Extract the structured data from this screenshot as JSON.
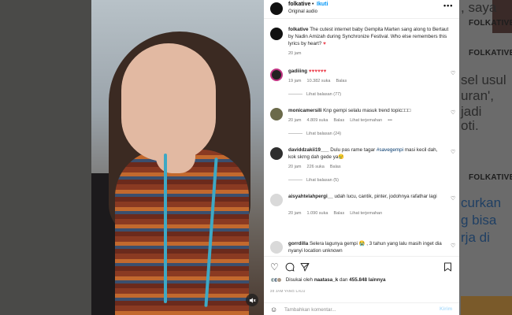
{
  "background": {
    "brand_top": "FOLKATIVE",
    "brand_mid": "FOLKATIVE",
    "brand_low": "FOLKATIVE",
    "snippet_top": ", saya",
    "snippet_lines_1": [
      "sel usul",
      "uran',",
      "jadi",
      "oti."
    ],
    "snippet_lines_2": [
      "curkan",
      "g bisa",
      "rja di"
    ]
  },
  "header": {
    "account": "folkative",
    "separator": "•",
    "follow_label": "Ikuti",
    "audio": "Original audio",
    "more_label": "•••"
  },
  "caption": {
    "user": "folkative",
    "text": " The cutest internet baby Gempita Marten sang along to Bertaut by Nadin Amizah during Synchronize Festival. Who else remembers this lyrics by heart? ",
    "heart": "♥",
    "time": "20 jam"
  },
  "comments": [
    {
      "user": "gadiiing",
      "text": " ♥♥♥♥♥♥",
      "time": "19 jam",
      "likes": "10.382 suka",
      "reply": "Balas",
      "translate": "",
      "replies": "Lihat balasan (77)"
    },
    {
      "user": "monicamersili",
      "text": " Knp gempi selalu masuk trend topic□□□",
      "time": "20 jam",
      "likes": "4.809 suka",
      "reply": "Balas",
      "translate": "Lihat terjemahan",
      "extra": "•••",
      "replies": "Lihat balasan (24)"
    },
    {
      "user": "daviddzakii19___",
      "text_before": " Dulu pas rame tagar ",
      "tag": "#savegempi",
      "text_after": " masi kecil dah, kok skrng dah gede ya😢",
      "time": "20 jam",
      "likes": "226 suka",
      "reply": "Balas",
      "translate": "",
      "replies": "Lihat balasan (5)"
    },
    {
      "user": "aisyahtelahpergi__",
      "text": " udah lucu, cantik, pinter, jodohnya rafathar lagi",
      "time": "20 jam",
      "likes": "1.090 suka",
      "reply": "Balas",
      "translate": "Lihat terjemahan",
      "replies": ""
    },
    {
      "user": "gorrdilla",
      "text": " Selera lagunya gempi 😭 , 3 tahun yang lalu masih inget dia nyanyi location unknown",
      "time": "",
      "likes": "",
      "reply": "",
      "translate": "",
      "replies": ""
    }
  ],
  "actions": {
    "liked_prefix": "Disukai oleh ",
    "liked_user": "naatasa_k",
    "liked_mid": " dan ",
    "liked_count": "455.848 lainnya",
    "time_ago": "20 JAM YANG LALU",
    "comment_placeholder": "Tambahkan komentar...",
    "post_label": "Kirim"
  },
  "icons": {
    "heart": "heart-icon",
    "comment": "comment-icon",
    "share": "share-icon",
    "bookmark": "bookmark-icon",
    "emoji": "emoji-icon",
    "mute": "mute-icon"
  },
  "colors": {
    "link_blue": "#0095f6",
    "like_red": "#ed4956",
    "post_disabled": "#b2dffc"
  }
}
